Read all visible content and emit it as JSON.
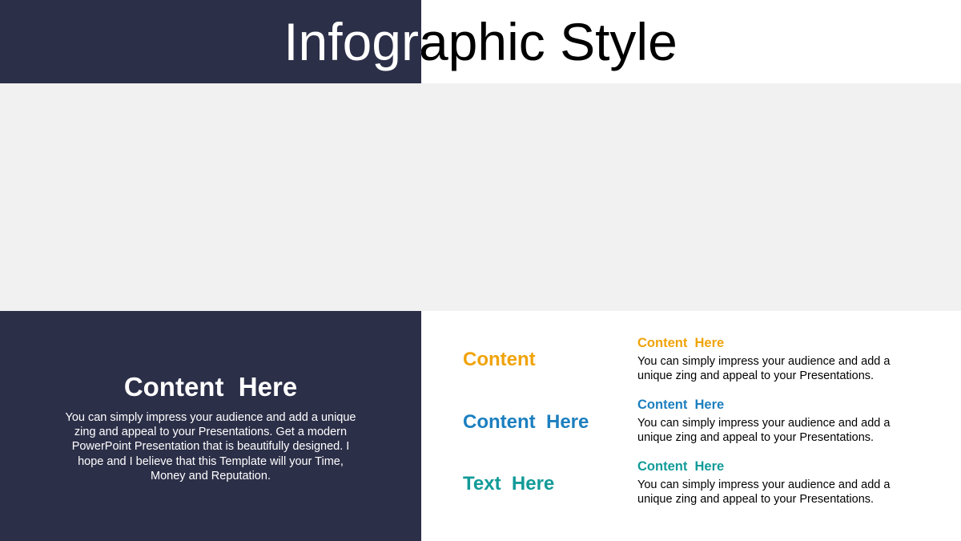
{
  "title": "Infographic Style",
  "left_panel": {
    "heading": "Content  Here",
    "body": "You can simply impress your audience and add a unique zing and appeal to your Presentations. Get a modern PowerPoint  Presentation that is beautifully designed. I hope and I  believe that this Template will your Time, Money and Reputation."
  },
  "rows": [
    {
      "label": "Content",
      "title": "Content  Here",
      "body": "You can simply impress your audience and add a unique zing and appeal to your Presentations.",
      "color": "#f0a30a"
    },
    {
      "label": "Content  Here",
      "title": "Content  Here",
      "body": "You can simply impress your audience and add a unique zing and appeal to your Presentations.",
      "color": "#1c7fbf"
    },
    {
      "label": "Text  Here",
      "title": "Content  Here",
      "body": "You can simply impress your audience and add a unique zing and appeal to your Presentations.",
      "color": "#129b98"
    }
  ],
  "colors": {
    "dark_panel": "#2c2f48",
    "image_placeholder": "#f1f1f1"
  }
}
